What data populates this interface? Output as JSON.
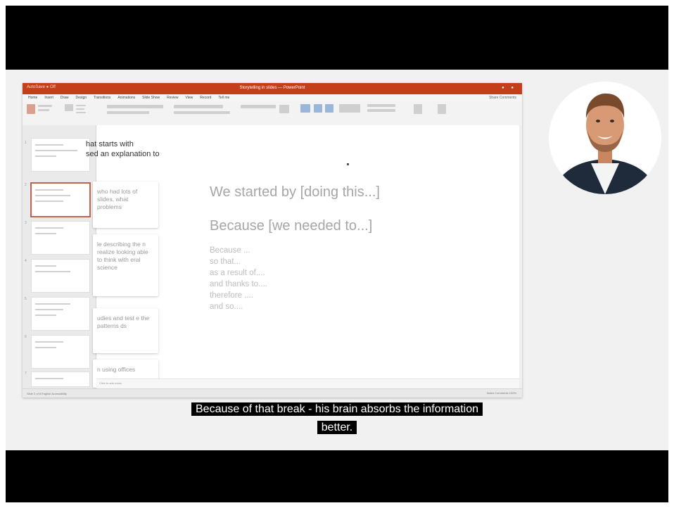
{
  "ppt": {
    "app_label": "AutoSave ● Off",
    "doc_title": "Storytelling in slides — PowerPoint",
    "menu": [
      "Home",
      "Insert",
      "Draw",
      "Design",
      "Transitions",
      "Animations",
      "Slide Show",
      "Review",
      "View",
      "Record",
      "Tell me"
    ],
    "menu_right": "Share  Comments"
  },
  "slide": {
    "intro_line1": "hat starts with",
    "intro_line2": "sed an explanation to",
    "cards": [
      "who had lots of slides, what problems",
      "le describing the n realize looking able to think with eral science",
      "udies and test e the patterns ds",
      "n using offices"
    ],
    "heading1": "We started by [doing this...]",
    "heading2": "Because [we needed to...]",
    "lines": [
      "Because ...",
      "so that...",
      "as a result of....",
      "and thanks to....",
      "therefore ....",
      "and so...."
    ],
    "notes_placeholder": "Click to add notes"
  },
  "status": {
    "left": "Slide 2 of 8   English   Accessibility",
    "right": "Notes   Comments   100%"
  },
  "caption": {
    "line1": "Because of that break - his brain absorbs the information",
    "line2": "better."
  },
  "colors": {
    "titlebar": "#c43e1c",
    "caption_bg": "#000000",
    "placeholder_gray": "#a6a6a6"
  }
}
